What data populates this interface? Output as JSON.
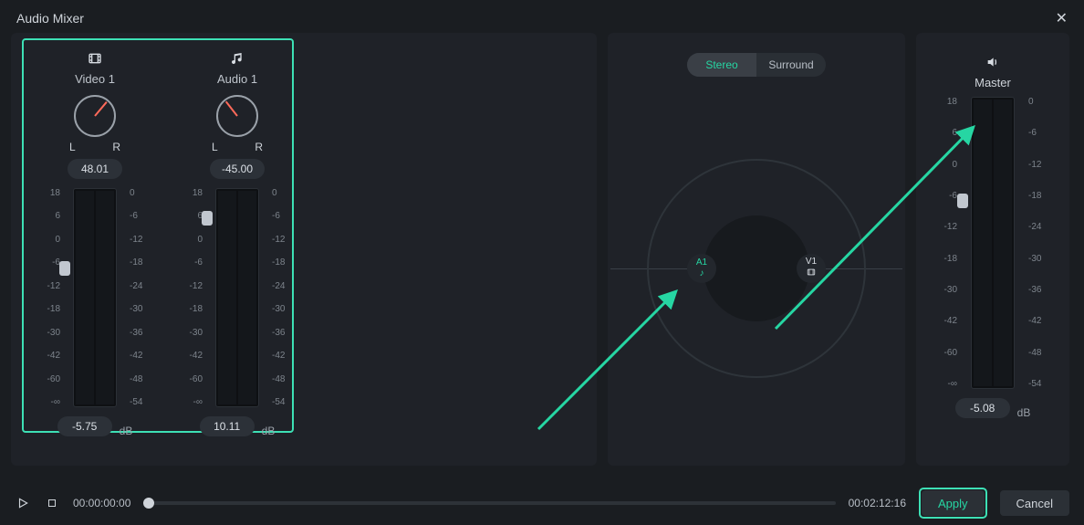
{
  "title": "Audio Mixer",
  "channels": [
    {
      "id": "video1",
      "icon": "film-icon",
      "name": "Video  1",
      "pan_value": "48.01",
      "pan_rotation_deg": 40,
      "gain_db": "-5.75",
      "slider_top_pct": 33
    },
    {
      "id": "audio1",
      "icon": "music-icon",
      "name": "Audio  1",
      "pan_value": "-45.00",
      "pan_rotation_deg": -38,
      "gain_db": "10.11",
      "slider_top_pct": 10
    }
  ],
  "pan_labels": {
    "left": "L",
    "right": "R"
  },
  "db_unit_label": "dB",
  "meter_scale_left": [
    "18",
    "6",
    "0",
    "-6",
    "-12",
    "-18",
    "-30",
    "-42",
    "-60",
    "-∞"
  ],
  "meter_scale_right": [
    "0",
    "-6",
    "-12",
    "-18",
    "-24",
    "-30",
    "-36",
    "-42",
    "-48",
    "-54"
  ],
  "mode_toggle": {
    "stereo": "Stereo",
    "surround": "Surround",
    "active": "stereo"
  },
  "surround_nodes": [
    {
      "id": "A1",
      "label": "A1",
      "icon": "music-icon",
      "active": true
    },
    {
      "id": "V1",
      "label": "V1",
      "icon": "film-icon",
      "active": false
    }
  ],
  "master": {
    "label": "Master",
    "gain_db": "-5.08",
    "slider_top_pct": 33,
    "scale_left": [
      "18",
      "6",
      "0",
      "-6",
      "-12",
      "-18",
      "-30",
      "-42",
      "-60",
      "-∞"
    ],
    "scale_right": [
      "0",
      "-6",
      "-12",
      "-18",
      "-24",
      "-30",
      "-36",
      "-42",
      "-48",
      "-54"
    ]
  },
  "playback": {
    "time_start": "00:00:00:00",
    "time_end": "00:02:12:16"
  },
  "buttons": {
    "apply": "Apply",
    "cancel": "Cancel"
  },
  "colors": {
    "accent": "#3de0b5",
    "accent_text": "#26d6a3"
  }
}
